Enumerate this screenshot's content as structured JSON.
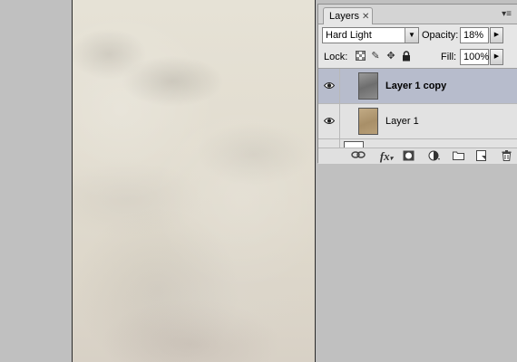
{
  "panel": {
    "tab_label": "Layers",
    "tab_close": "✕",
    "menu_icon": "panel-menu-icon",
    "blend_mode": "Hard Light",
    "opacity_label": "Opacity:",
    "opacity_value": "18%",
    "lock_label": "Lock:",
    "fill_label": "Fill:",
    "fill_value": "100%"
  },
  "layers": [
    {
      "name": "Layer 1 copy",
      "selected": true,
      "visible": true
    },
    {
      "name": "Layer 1",
      "selected": false,
      "visible": true
    }
  ],
  "footer": {
    "fx_label": "fx",
    "icons": [
      "link-layers-icon",
      "fx-icon",
      "add-mask-icon",
      "adjustment-layer-icon",
      "new-group-icon",
      "new-layer-icon",
      "trash-icon"
    ]
  },
  "colors": {
    "selected_row": "#b7bccc",
    "workspace": "#c0c0c0"
  }
}
